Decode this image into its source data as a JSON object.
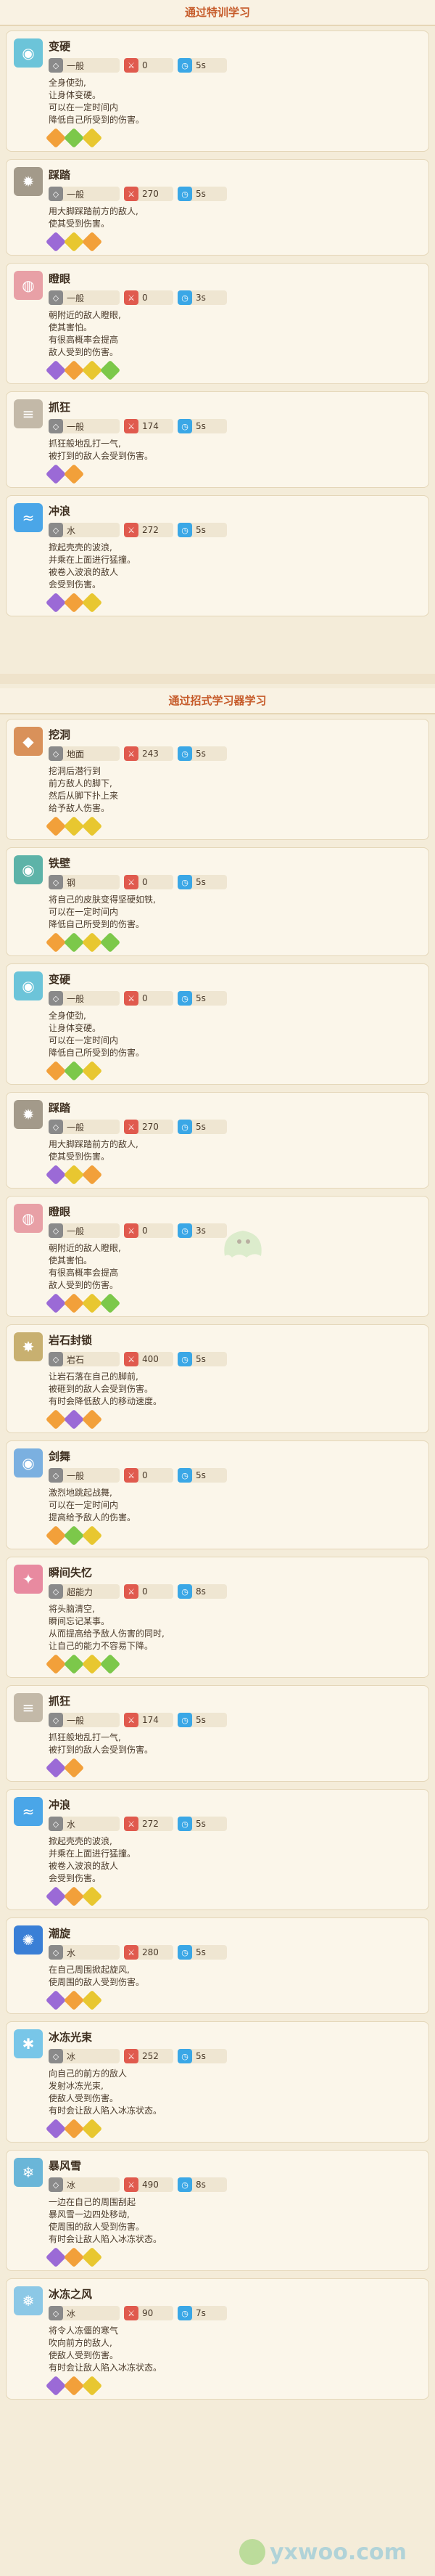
{
  "sections": [
    {
      "title": "通过特训学习",
      "cards": [
        {
          "name": "变硬",
          "icon": "robot-face-icon",
          "icon_bg": "#6cc4d9",
          "type": "一般",
          "power": "0",
          "cd": "5s",
          "desc": "全身使劲,\n让身体变硬。\n可以在一定时间内\n降低自己所受到的伤害。",
          "tags": [
            "orange",
            "green",
            "yellow"
          ]
        },
        {
          "name": "踩踏",
          "icon": "foot-stomp-icon",
          "icon_bg": "#a39a8a",
          "type": "一般",
          "power": "270",
          "cd": "5s",
          "desc": "用大脚踩踏前方的敌人,\n使其受到伤害。",
          "tags": [
            "purple",
            "yellow",
            "orange"
          ]
        },
        {
          "name": "瞪眼",
          "icon": "glare-eye-icon",
          "icon_bg": "#e8a0a6",
          "type": "一般",
          "power": "0",
          "cd": "3s",
          "desc": "朝附近的敌人瞪眼,\n使其害怕。\n有很高概率会提高\n敌人受到的伤害。",
          "tags": [
            "purple",
            "orange",
            "yellow",
            "green"
          ]
        },
        {
          "name": "抓狂",
          "icon": "claw-icon",
          "icon_bg": "#c3b9a8",
          "type": "一般",
          "power": "174",
          "cd": "5s",
          "desc": "抓狂般地乱打一气,\n被打到的敌人会受到伤害。",
          "tags": [
            "purple",
            "orange"
          ]
        },
        {
          "name": "冲浪",
          "icon": "wave-icon",
          "icon_bg": "#4aa6e8",
          "type": "水",
          "power": "272",
          "cd": "5s",
          "desc": "掀起壳壳的波浪,\n并乘在上面进行猛撞。\n被卷入波浪的敌人\n会受到伤害。",
          "tags": [
            "purple",
            "orange",
            "yellow"
          ]
        }
      ]
    },
    {
      "title": "通过招式学习器学习",
      "cards": [
        {
          "name": "挖洞",
          "icon": "dig-icon",
          "icon_bg": "#d9915a",
          "type": "地面",
          "power": "243",
          "cd": "5s",
          "desc": "挖洞后潜行到\n前方敌人的脚下,\n然后从脚下扑上来\n给予敌人伤害。",
          "tags": [
            "orange",
            "yellow",
            "yellow"
          ]
        },
        {
          "name": "铁壁",
          "icon": "robot-face-icon",
          "icon_bg": "#5db3a8",
          "type": "钢",
          "power": "0",
          "cd": "5s",
          "desc": "将自己的皮肤变得坚硬如铁,\n可以在一定时间内\n降低自己所受到的伤害。",
          "tags": [
            "orange",
            "green",
            "yellow",
            "green"
          ]
        },
        {
          "name": "变硬",
          "icon": "robot-face-icon",
          "icon_bg": "#6cc4d9",
          "type": "一般",
          "power": "0",
          "cd": "5s",
          "desc": "全身使劲,\n让身体变硬。\n可以在一定时间内\n降低自己所受到的伤害。",
          "tags": [
            "orange",
            "green",
            "yellow"
          ]
        },
        {
          "name": "踩踏",
          "icon": "foot-stomp-icon",
          "icon_bg": "#a39a8a",
          "type": "一般",
          "power": "270",
          "cd": "5s",
          "desc": "用大脚踩踏前方的敌人,\n使其受到伤害。",
          "tags": [
            "purple",
            "yellow",
            "orange"
          ]
        },
        {
          "name": "瞪眼",
          "icon": "glare-eye-icon",
          "icon_bg": "#e8a0a6",
          "type": "一般",
          "power": "0",
          "cd": "3s",
          "desc": "朝附近的敌人瞪眼,\n使其害怕。\n有很高概率会提高\n敌人受到的伤害。",
          "tags": [
            "purple",
            "orange",
            "yellow",
            "green"
          ]
        },
        {
          "name": "岩石封锁",
          "icon": "rock-burst-icon",
          "icon_bg": "#c8b070",
          "type": "岩石",
          "power": "400",
          "cd": "5s",
          "desc": "让岩石落在自己的脚前,\n被砸到的敌人会受到伤害。\n有时会降低敌人的移动速度。",
          "tags": [
            "orange",
            "purple",
            "orange"
          ]
        },
        {
          "name": "剑舞",
          "icon": "robot-face-icon",
          "icon_bg": "#7bb0e0",
          "type": "一般",
          "power": "0",
          "cd": "5s",
          "desc": "激烈地跳起战舞,\n可以在一定时间内\n提高给予敌人的伤害。",
          "tags": [
            "orange",
            "green",
            "yellow"
          ]
        },
        {
          "name": "瞬间失忆",
          "icon": "memory-icon",
          "icon_bg": "#e88aa0",
          "type": "超能力",
          "power": "0",
          "cd": "8s",
          "desc": "将头脑清空,\n瞬间忘记某事。\n从而提高给予敌人伤害的同时,\n让自己的能力不容易下降。",
          "tags": [
            "orange",
            "green",
            "yellow",
            "green"
          ]
        },
        {
          "name": "抓狂",
          "icon": "claw-icon",
          "icon_bg": "#c3b9a8",
          "type": "一般",
          "power": "174",
          "cd": "5s",
          "desc": "抓狂般地乱打一气,\n被打到的敌人会受到伤害。",
          "tags": [
            "purple",
            "orange"
          ]
        },
        {
          "name": "冲浪",
          "icon": "wave-icon",
          "icon_bg": "#4aa6e8",
          "type": "水",
          "power": "272",
          "cd": "5s",
          "desc": "掀起壳壳的波浪,\n并乘在上面进行猛撞。\n被卷入波浪的敌人\n会受到伤害。",
          "tags": [
            "purple",
            "orange",
            "yellow"
          ]
        },
        {
          "name": "潮旋",
          "icon": "whirlpool-icon",
          "icon_bg": "#3a7fd6",
          "type": "水",
          "power": "280",
          "cd": "5s",
          "desc": "在自己周围掀起旋风,\n使周围的敌人受到伤害。",
          "tags": [
            "purple",
            "orange",
            "yellow"
          ]
        },
        {
          "name": "冰冻光束",
          "icon": "ice-beam-icon",
          "icon_bg": "#78c6e8",
          "type": "冰",
          "power": "252",
          "cd": "5s",
          "desc": "向自己的前方的敌人\n发射冰冻光束,\n使敌人受到伤害。\n有时会让敌人陷入冰冻状态。",
          "tags": [
            "purple",
            "orange",
            "yellow"
          ]
        },
        {
          "name": "暴风雪",
          "icon": "blizzard-icon",
          "icon_bg": "#6ab6d8",
          "type": "冰",
          "power": "490",
          "cd": "8s",
          "desc": "一边在自己的周围刮起\n暴风雪一边四处移动,\n使周围的敌人受到伤害。\n有时会让敌人陷入冰冻状态。",
          "tags": [
            "purple",
            "orange",
            "yellow"
          ]
        },
        {
          "name": "冰冻之风",
          "icon": "frost-wind-icon",
          "icon_bg": "#8cc8e6",
          "type": "冰",
          "power": "90",
          "cd": "7s",
          "desc": "将令人冻僵的寒气\n吹向前方的敌人,\n使敌人受到伤害。\n有时会让敌人陷入冰冻状态。",
          "tags": [
            "purple",
            "orange",
            "yellow"
          ]
        }
      ]
    }
  ],
  "watermark": "yxwoo.com"
}
